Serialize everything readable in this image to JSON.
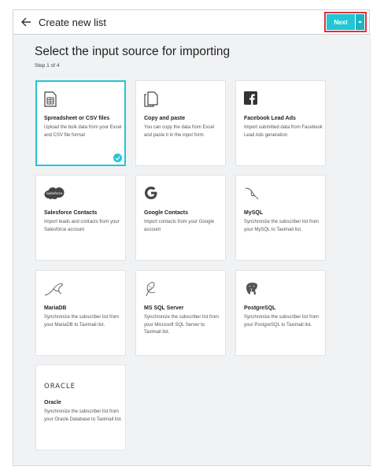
{
  "header": {
    "title": "Create new list",
    "next_label": "Next"
  },
  "main": {
    "title": "Select the input source for importing",
    "step": "Step 1 of 4"
  },
  "sources": [
    {
      "title": "Spreadsheet or CSV files",
      "desc": "Upload the bulk data from your Excel and CSV file format",
      "icon": "spreadsheet-icon",
      "selected": true
    },
    {
      "title": "Copy and paste",
      "desc": "You can copy the data from Excel and paste it in the input form",
      "icon": "clipboard-icon"
    },
    {
      "title": "Facebook Lead Ads",
      "desc": "Import submitted data from Facebook Lead Ads generation",
      "icon": "facebook-icon"
    },
    {
      "title": "Salesforce Contacts",
      "desc": "Import leads and contacts from your Salesforce account",
      "icon": "salesforce-icon",
      "logo_text": "salesforce"
    },
    {
      "title": "Google Contacts",
      "desc": "Import contacts from your Google account",
      "icon": "google-icon"
    },
    {
      "title": "MySQL",
      "desc": "Synchronize the subscriber list from your MySQL to Taximail list.",
      "icon": "mysql-icon"
    },
    {
      "title": "MariaDB",
      "desc": "Synchronize the subscriber list from your MariaDB to Taximail list.",
      "icon": "mariadb-icon"
    },
    {
      "title": "MS SQL Server",
      "desc": "Synchronize the subscriber list from your Microsoft SQL Server to Taximail list.",
      "icon": "mssql-icon"
    },
    {
      "title": "PostgreSQL",
      "desc": "Synchronize the subscriber list from your PostgreSQL to Taximail list.",
      "icon": "postgresql-icon"
    },
    {
      "title": "Oracle",
      "desc": "Synchronize the subscriber list from your Oracle Database to Taximail list.",
      "icon": "oracle-icon",
      "logo_text": "ORACLE"
    }
  ],
  "colors": {
    "accent": "#22c6d4",
    "highlight_border": "#e0303a",
    "background": "#f1f2f4"
  }
}
